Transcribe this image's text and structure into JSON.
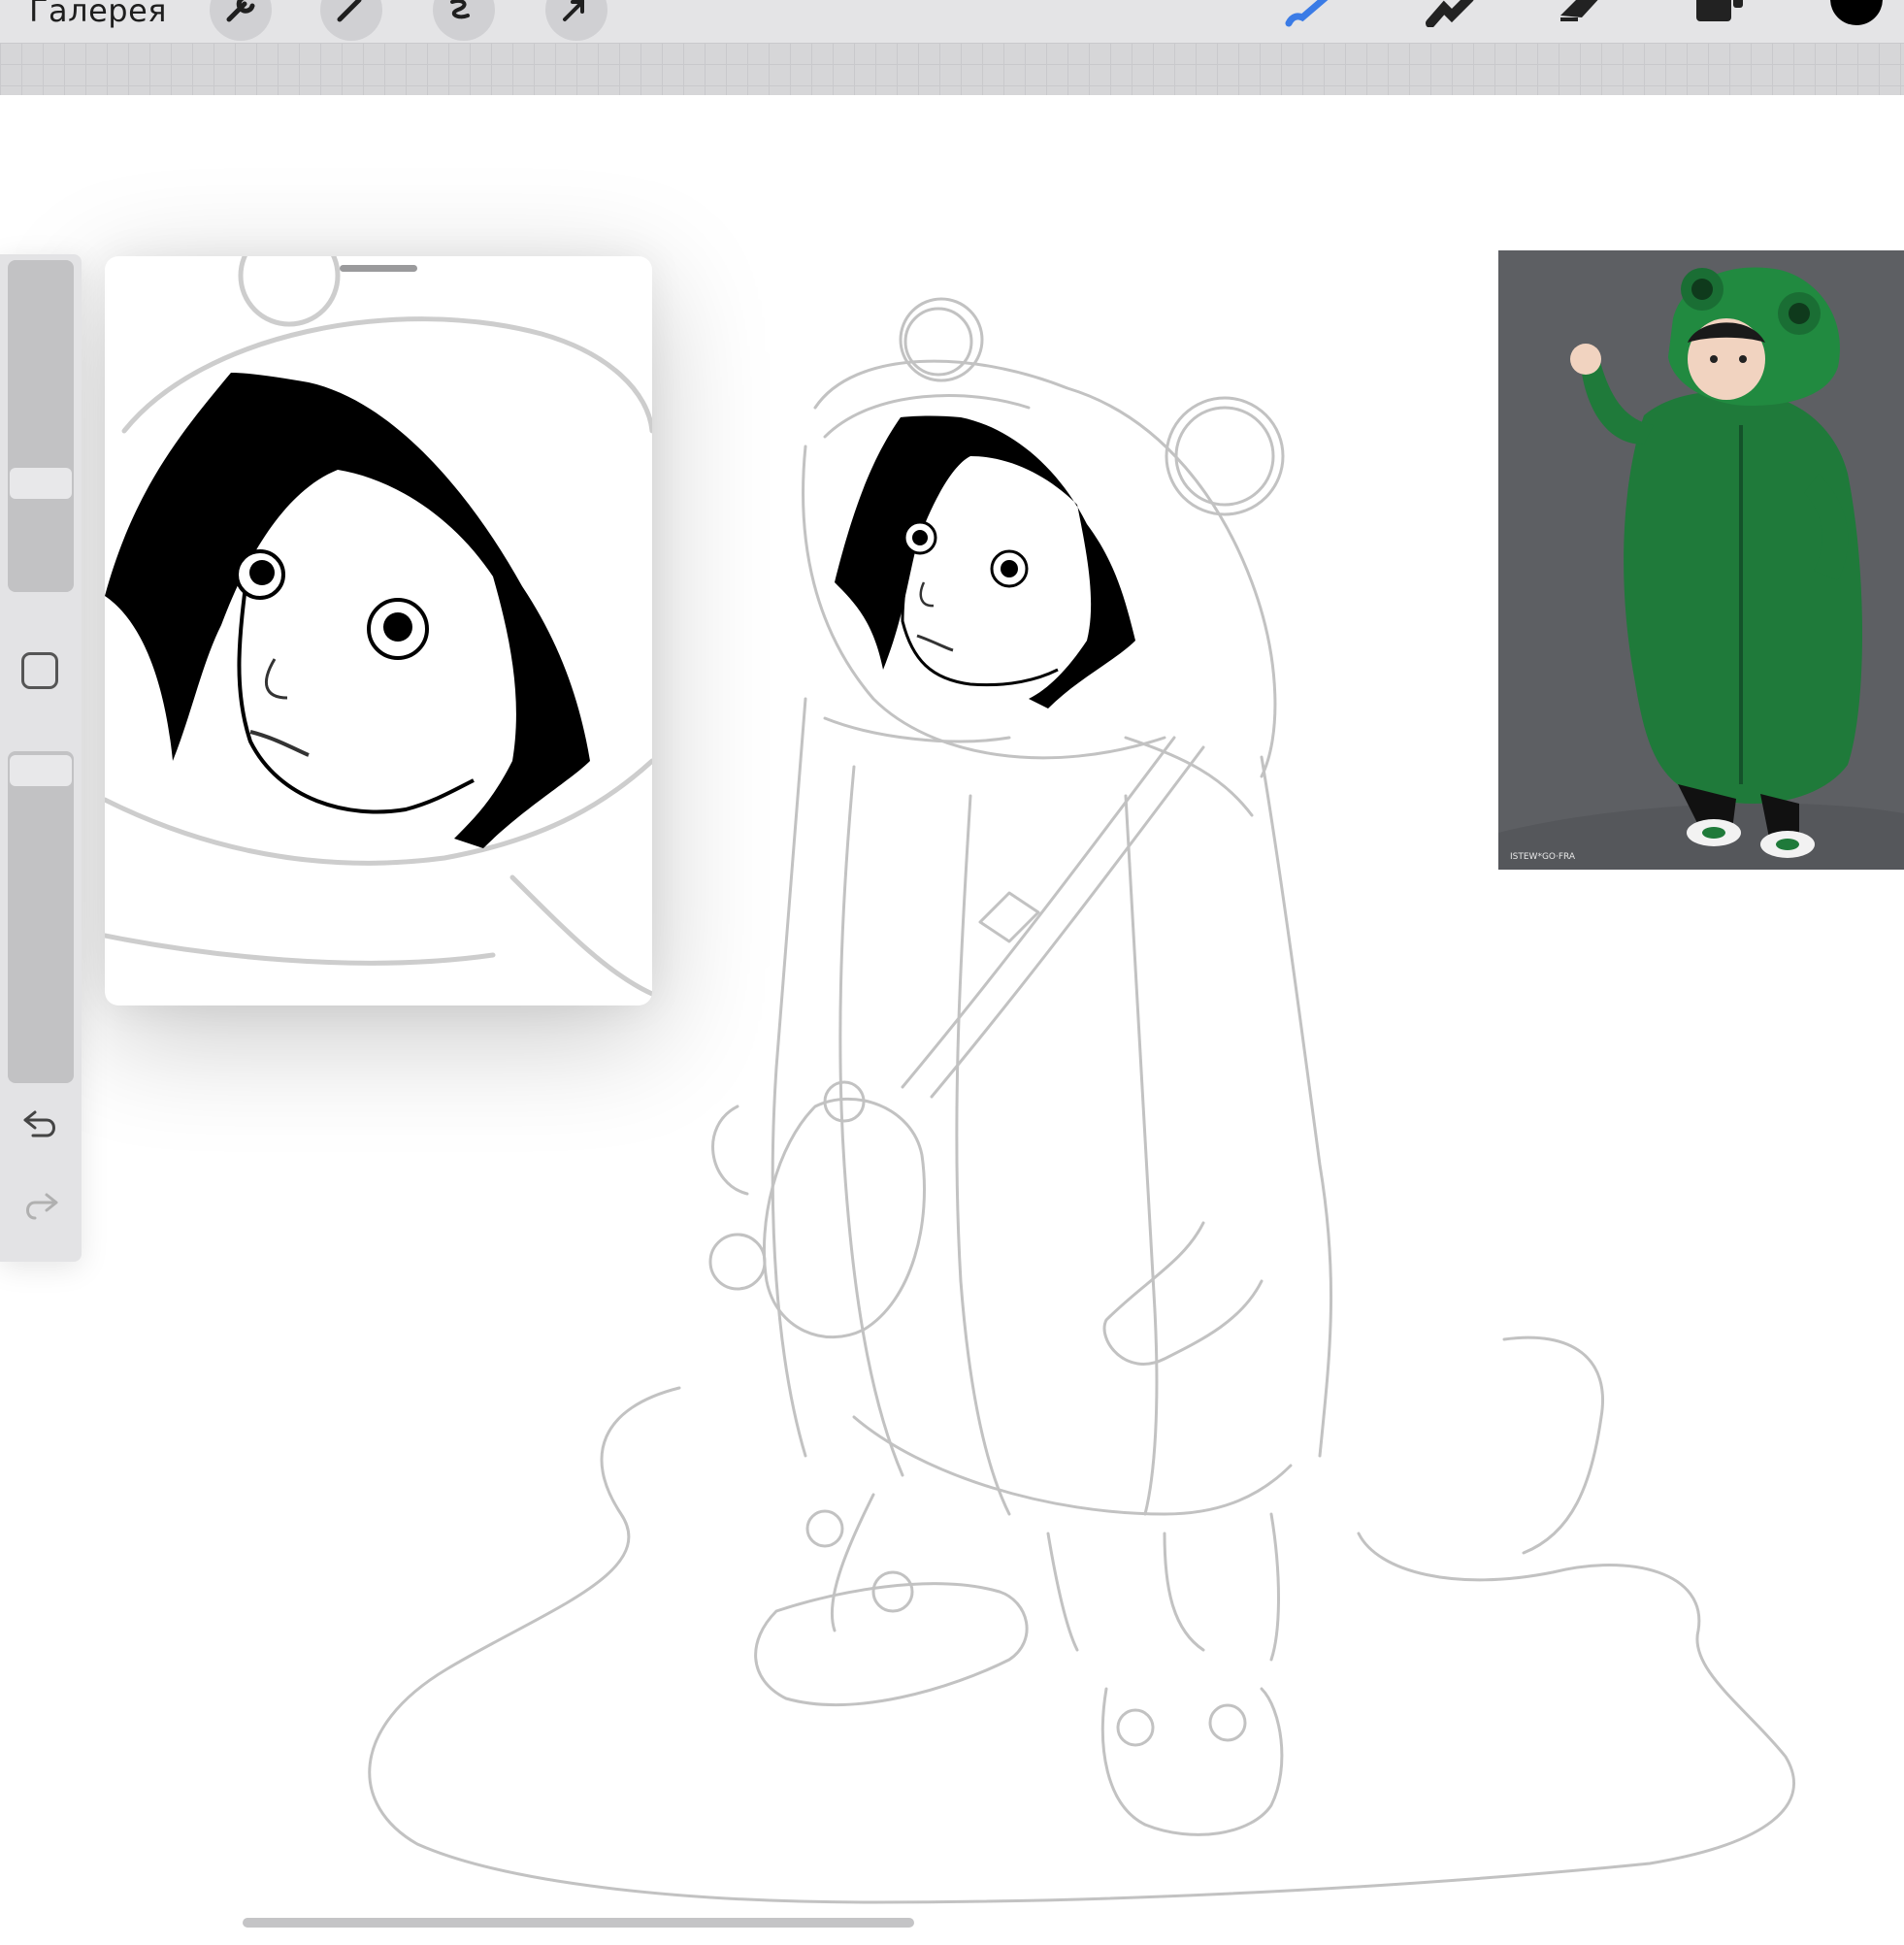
{
  "toolbar": {
    "gallery_label": "Галерея",
    "left_tools": [
      "wrench-icon",
      "magic-wand-icon",
      "selection-icon",
      "transform-arrow-icon"
    ],
    "right_tools": [
      "brush-icon",
      "smudge-icon",
      "eraser-icon",
      "layers-icon",
      "color-swatch-icon"
    ],
    "active_tool": "brush-icon",
    "active_color": "#3a7be6",
    "current_color": "#000000"
  },
  "sidebar": {
    "brush_size_slider": "brush-size-slider",
    "opacity_slider": "opacity-slider",
    "modify_button": "square-modify-button",
    "undo": "undo-icon",
    "redo": "redo-icon"
  },
  "reference_window": {
    "content": "zoomed-sketch-face"
  },
  "reference_photo": {
    "caption": "ISTEW*GO·FRA"
  }
}
